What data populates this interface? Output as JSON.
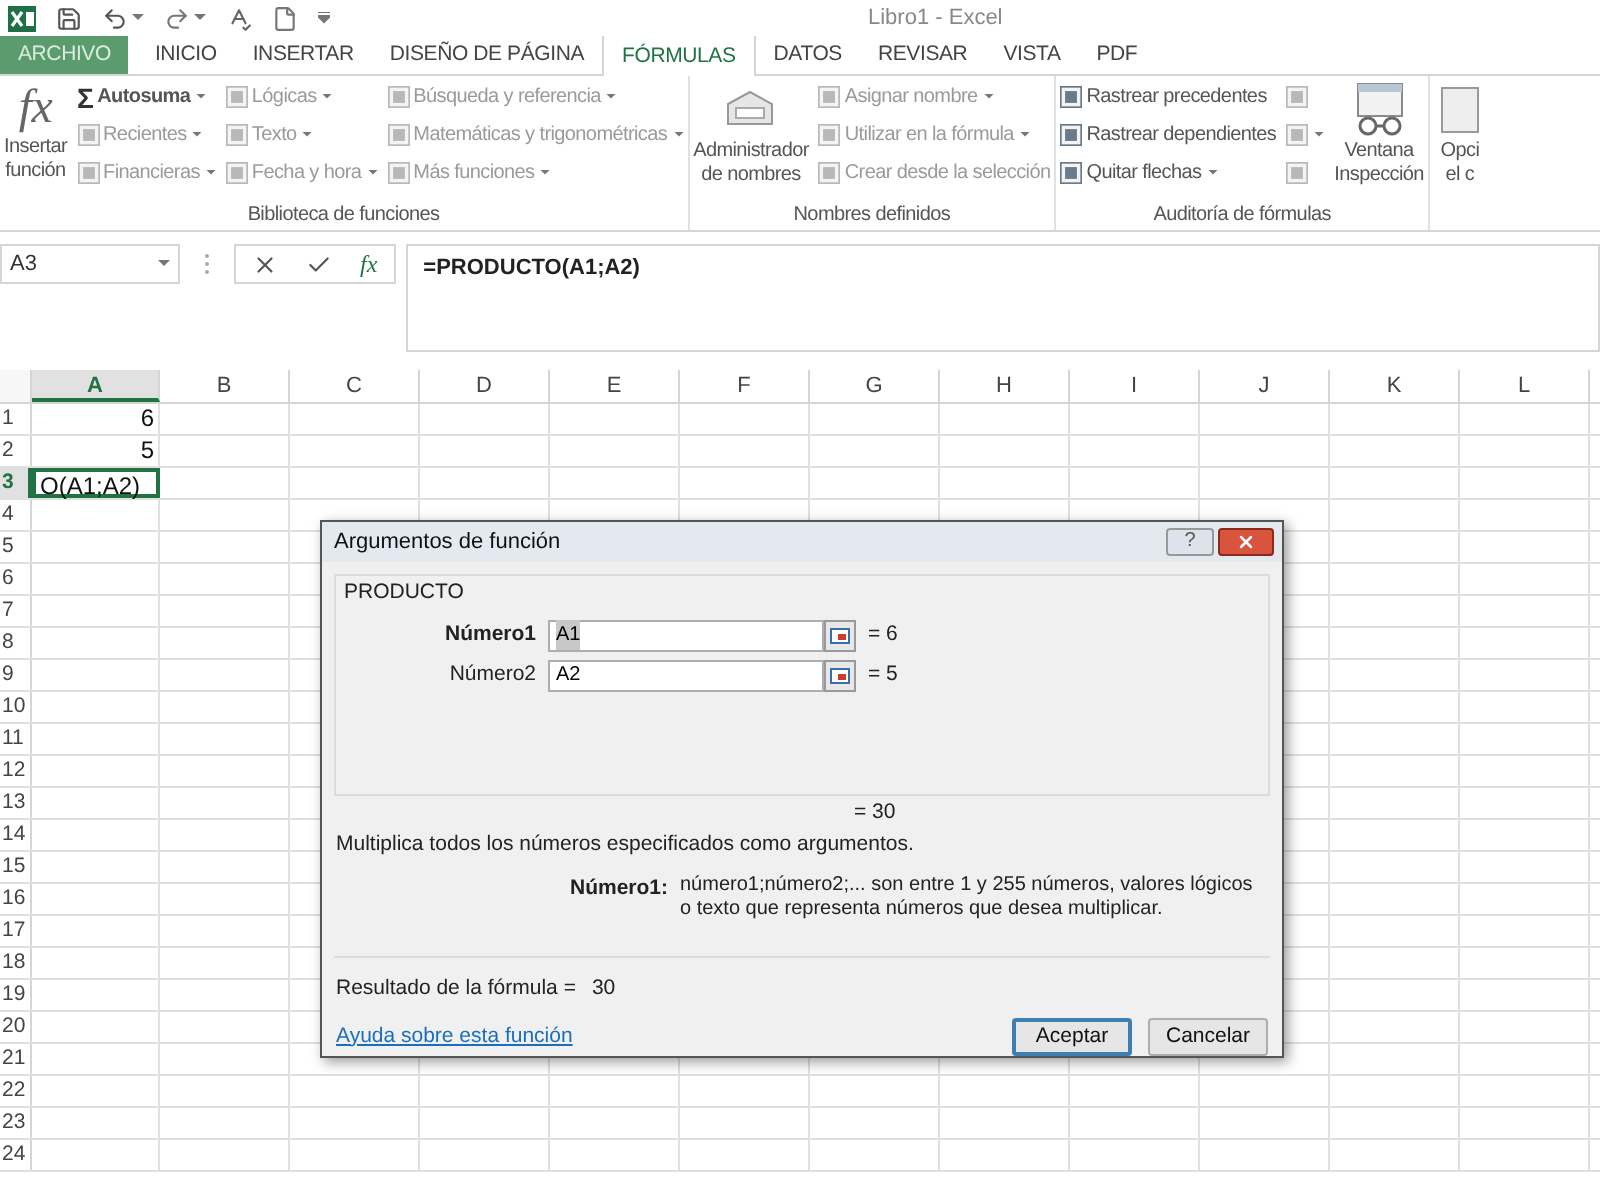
{
  "window": {
    "title": "Libro1 - Excel"
  },
  "tabs": [
    {
      "label": "ARCHIVO",
      "kind": "file",
      "selected": false
    },
    {
      "label": "INICIO",
      "kind": "tab",
      "selected": false
    },
    {
      "label": "INSERTAR",
      "kind": "tab",
      "selected": false
    },
    {
      "label": "DISEÑO DE PÁGINA",
      "kind": "tab",
      "selected": false
    },
    {
      "label": "FÓRMULAS",
      "kind": "tab",
      "selected": true
    },
    {
      "label": "DATOS",
      "kind": "tab",
      "selected": false
    },
    {
      "label": "REVISAR",
      "kind": "tab",
      "selected": false
    },
    {
      "label": "VISTA",
      "kind": "tab",
      "selected": false
    },
    {
      "label": "PDF",
      "kind": "tab",
      "selected": false
    }
  ],
  "ribbon": {
    "groups": [
      {
        "label": "Biblioteca de funciones",
        "items": [
          {
            "kind": "large",
            "glyph": "fx",
            "lines": [
              "Insertar",
              "función"
            ]
          },
          {
            "kind": "column",
            "buttons": [
              {
                "glyph": "Σ",
                "label": "Autosuma",
                "bold": true,
                "disabled": false,
                "dropdown": true
              },
              {
                "label": "Recientes",
                "bold": false,
                "disabled": true,
                "dropdown": true
              },
              {
                "label": "Financieras",
                "bold": false,
                "disabled": true,
                "dropdown": true
              }
            ]
          },
          {
            "kind": "column",
            "buttons": [
              {
                "label": "Lógicas",
                "bold": false,
                "disabled": true,
                "dropdown": true
              },
              {
                "label": "Texto",
                "bold": false,
                "disabled": true,
                "dropdown": true
              },
              {
                "label": "Fecha y hora",
                "bold": false,
                "disabled": true,
                "dropdown": true
              }
            ]
          },
          {
            "kind": "column",
            "buttons": [
              {
                "label": "Búsqueda y referencia",
                "bold": false,
                "disabled": true,
                "dropdown": true
              },
              {
                "label": "Matemáticas y trigonométricas",
                "bold": false,
                "disabled": true,
                "dropdown": true
              },
              {
                "label": "Más funciones",
                "bold": false,
                "disabled": true,
                "dropdown": true
              }
            ]
          }
        ]
      },
      {
        "label": "Nombres definidos",
        "items": [
          {
            "kind": "large",
            "lines": [
              "Administrador",
              "de nombres"
            ]
          },
          {
            "kind": "column",
            "buttons": [
              {
                "label": "Asignar nombre",
                "bold": false,
                "disabled": true,
                "dropdown": true
              },
              {
                "label": "Utilizar en la fórmula",
                "bold": false,
                "disabled": true,
                "dropdown": true
              },
              {
                "label": "Crear desde la selección",
                "bold": false,
                "disabled": true,
                "dropdown": false
              }
            ]
          }
        ]
      },
      {
        "label": "Auditoría de fórmulas",
        "items": [
          {
            "kind": "column",
            "buttons": [
              {
                "label": "Rastrear precedentes",
                "bold": false,
                "disabled": false,
                "dropdown": false
              },
              {
                "label": "Rastrear dependientes",
                "bold": false,
                "disabled": false,
                "dropdown": false
              },
              {
                "label": "Quitar flechas",
                "bold": false,
                "disabled": false,
                "dropdown": true
              }
            ]
          },
          {
            "kind": "column",
            "buttons": [
              {
                "bold": false,
                "disabled": true,
                "dropdown": false
              },
              {
                "bold": false,
                "disabled": true,
                "dropdown": true
              },
              {
                "bold": false,
                "disabled": true,
                "dropdown": false
              }
            ]
          },
          {
            "kind": "large",
            "lines": [
              "Ventana",
              "Inspección"
            ]
          }
        ]
      },
      {
        "items": [
          {
            "kind": "large",
            "lines": [
              "Opci",
              "el c"
            ]
          }
        ]
      }
    ]
  },
  "formula_bar": {
    "name_box": "A3",
    "fx": "fx",
    "formula": "=PRODUCTO(A1;A2)"
  },
  "sheet": {
    "columns": [
      {
        "label": "A",
        "selected": true
      },
      {
        "label": "B",
        "selected": false
      },
      {
        "label": "C",
        "selected": false
      },
      {
        "label": "D",
        "selected": false
      },
      {
        "label": "E",
        "selected": false
      },
      {
        "label": "F",
        "selected": false
      },
      {
        "label": "G",
        "selected": false
      },
      {
        "label": "H",
        "selected": false
      },
      {
        "label": "I",
        "selected": false
      },
      {
        "label": "J",
        "selected": false
      },
      {
        "label": "K",
        "selected": false
      },
      {
        "label": "L",
        "selected": false
      }
    ],
    "rows": [
      {
        "label": "1",
        "selected": false,
        "cells": [
          {
            "value": "6",
            "kind": "number",
            "active": false
          }
        ]
      },
      {
        "label": "2",
        "selected": false,
        "cells": [
          {
            "value": "5",
            "kind": "number",
            "active": false
          }
        ]
      },
      {
        "label": "3",
        "selected": true,
        "cells": [
          {
            "value": "O(A1;A2)",
            "kind": "text",
            "active": true
          }
        ]
      },
      {
        "label": "4",
        "selected": false
      },
      {
        "label": "5",
        "selected": false
      },
      {
        "label": "6",
        "selected": false
      },
      {
        "label": "7",
        "selected": false
      },
      {
        "label": "8",
        "selected": false
      },
      {
        "label": "9",
        "selected": false
      },
      {
        "label": "10",
        "selected": false
      },
      {
        "label": "11",
        "selected": false
      },
      {
        "label": "12",
        "selected": false
      },
      {
        "label": "13",
        "selected": false
      },
      {
        "label": "14",
        "selected": false
      },
      {
        "label": "15",
        "selected": false
      },
      {
        "label": "16",
        "selected": false
      },
      {
        "label": "17",
        "selected": false
      },
      {
        "label": "18",
        "selected": false
      },
      {
        "label": "19",
        "selected": false
      },
      {
        "label": "20",
        "selected": false
      },
      {
        "label": "21",
        "selected": false
      },
      {
        "label": "22",
        "selected": false
      },
      {
        "label": "23",
        "selected": false
      },
      {
        "label": "24",
        "selected": false
      }
    ]
  },
  "dialog": {
    "title": "Argumentos de función",
    "help": "?",
    "function": "PRODUCTO",
    "arguments": [
      {
        "label": "Número1",
        "value": "A1",
        "result": "= 6",
        "focused": true
      },
      {
        "label": "Número2",
        "value": "A2",
        "result": "= 5",
        "focused": false
      }
    ],
    "total": "= 30",
    "description": "Multiplica todos los números especificados como argumentos.",
    "argument_help": {
      "label": "Número1:",
      "text": "número1;número2;... son entre 1 y 255 números, valores lógicos o texto que representa números que desea multiplicar."
    },
    "result_label": "Resultado de la fórmula =",
    "result_value": "30",
    "help_link": "Ayuda sobre esta función",
    "buttons": [
      {
        "label": "Aceptar",
        "default": true
      },
      {
        "label": "Cancelar",
        "default": false
      }
    ]
  }
}
